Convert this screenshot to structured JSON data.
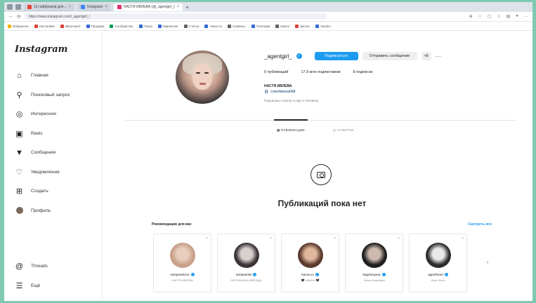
{
  "browser": {
    "tabs": [
      {
        "label": "13 лайфхаков для...",
        "color": "#ea4335"
      },
      {
        "label": "Instagram",
        "color": "#4285f4"
      },
      {
        "label": "НАСТЯ ИВЛЕВА (@_agentgirl_)",
        "color": "#e1306c",
        "active": true
      }
    ],
    "new_tab": "+",
    "url": "https://www.instagram.com/_agentgirl_/",
    "bookmarks": [
      {
        "label": "Избранное",
        "color": "#f4b400"
      },
      {
        "label": "Настройки",
        "color": "#db4437"
      },
      {
        "label": "ВКонтакте",
        "color": "#db4437"
      },
      {
        "label": "Продажи",
        "color": "#3367d6"
      },
      {
        "label": "Сообщество",
        "color": "#0f9d58"
      },
      {
        "label": "Поиск",
        "color": "#3367d6"
      },
      {
        "label": "Маркетинг",
        "color": "#3367d6"
      },
      {
        "label": "Статьи",
        "color": "#5f6368"
      },
      {
        "label": "Новости",
        "color": "#3367d6"
      },
      {
        "label": "Сервисы",
        "color": "#5f6368"
      },
      {
        "label": "Телеграм",
        "color": "#3367d6"
      },
      {
        "label": "Карты",
        "color": "#5f6368"
      },
      {
        "label": "Школа",
        "color": "#db4437"
      },
      {
        "label": "Yandex",
        "color": "#3367d6"
      }
    ]
  },
  "sidebar": {
    "logo": "Instagram",
    "items": [
      {
        "label": "Главная",
        "icon": "home-icon",
        "glyph": "⌂"
      },
      {
        "label": "Поисковый запрос",
        "icon": "search-icon",
        "glyph": "⚲"
      },
      {
        "label": "Интересное",
        "icon": "compass-icon",
        "glyph": "◎"
      },
      {
        "label": "Reels",
        "icon": "reels-icon",
        "glyph": "▣"
      },
      {
        "label": "Сообщения",
        "icon": "messenger-icon",
        "glyph": "▼"
      },
      {
        "label": "Уведомления",
        "icon": "heart-icon",
        "glyph": "♡"
      },
      {
        "label": "Создать",
        "icon": "plus-square-icon",
        "glyph": "⊞"
      },
      {
        "label": "Профиль",
        "icon": "avatar-icon",
        "glyph": ""
      }
    ],
    "bottom": [
      {
        "label": "Threads",
        "icon": "threads-icon",
        "glyph": "@"
      },
      {
        "label": "Ещё",
        "icon": "menu-icon",
        "glyph": "☰"
      }
    ]
  },
  "profile": {
    "username": "_agentgirl_",
    "follow_label": "Подписаться",
    "message_label": "Отправить сообщение",
    "add_icon_label": "+8",
    "more_label": "···",
    "posts": "0 публикаций",
    "followers": "17,9 млн подписчиков",
    "following": "8 подписок",
    "full_name": "НАСТЯ ИВЛЕВА",
    "link": "t.me/ivleeva068",
    "followed_by": "Подписаны: twenty и ещё 3 человека"
  },
  "tabs": {
    "posts": "ПУБЛИКАЦИИ",
    "tagged": "ОТМЕТКИ"
  },
  "empty_state": {
    "title": "Публикаций пока нет"
  },
  "suggestions": {
    "title": "Рекомендации для вас",
    "see_all": "Смотреть все",
    "cards": [
      {
        "username": "nastyaivleeva",
        "sub": "НАСТЯ ИВЛЕВА",
        "color": "#caa08a",
        "color2": "#e9cdbd"
      },
      {
        "username": "instasamka",
        "sub": "INSTASAMKA (ЗВЕЗДА)",
        "color": "#3a3236",
        "color2": "#d8d2cf"
      },
      {
        "username": "hanna.ru",
        "sub": "🖤 HANNA 🖤",
        "color": "#5b3a2e",
        "color2": "#e0b79c"
      },
      {
        "username": "bagramyana",
        "sub": "Лилия Багромян",
        "color": "#1e1e1e",
        "color2": "#cdb9ad"
      },
      {
        "username": "agentfreed",
        "sub": "Ника Фоса",
        "color": "#2b2b2b",
        "color2": "#e9e9e9"
      }
    ],
    "next": "›"
  }
}
